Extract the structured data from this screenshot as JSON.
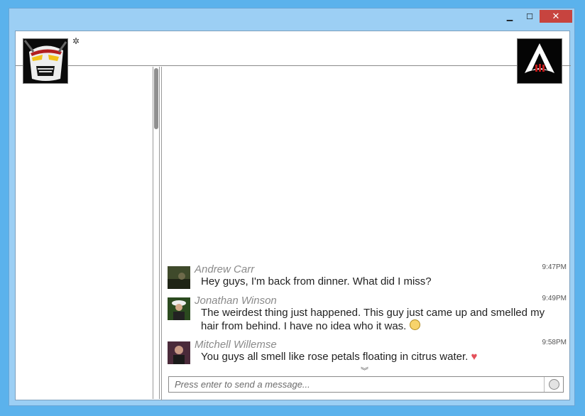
{
  "titlebar": {
    "minimize_icon": "minimize-icon",
    "maximize_icon": "maximize-icon",
    "close_icon": "close-icon",
    "minimize_glyph": "▁",
    "maximize_glyph": "☐",
    "close_glyph": "✕"
  },
  "header": {
    "status_glyph": "✲"
  },
  "messages": [
    {
      "name": "Andrew Carr",
      "time": "9:47PM",
      "text": "Hey guys, I'm back from dinner. What did I miss?"
    },
    {
      "name": "Jonathan Winson",
      "time": "9:49PM",
      "text": "The weirdest thing just happened. This guy just came up and smelled my hair from behind. I have no idea who it was."
    },
    {
      "name": "Mitchell Willemse",
      "time": "9:58PM",
      "text": "You guys all smell like rose petals floating in citrus water."
    }
  ],
  "heart_glyph": "♥",
  "scroll_down_glyph": "︾",
  "composer": {
    "placeholder": "Press enter to send a message..."
  },
  "colors": {
    "accent": "#c7443f",
    "window": "#9ccff4",
    "desktop": "#5bb2ec"
  }
}
